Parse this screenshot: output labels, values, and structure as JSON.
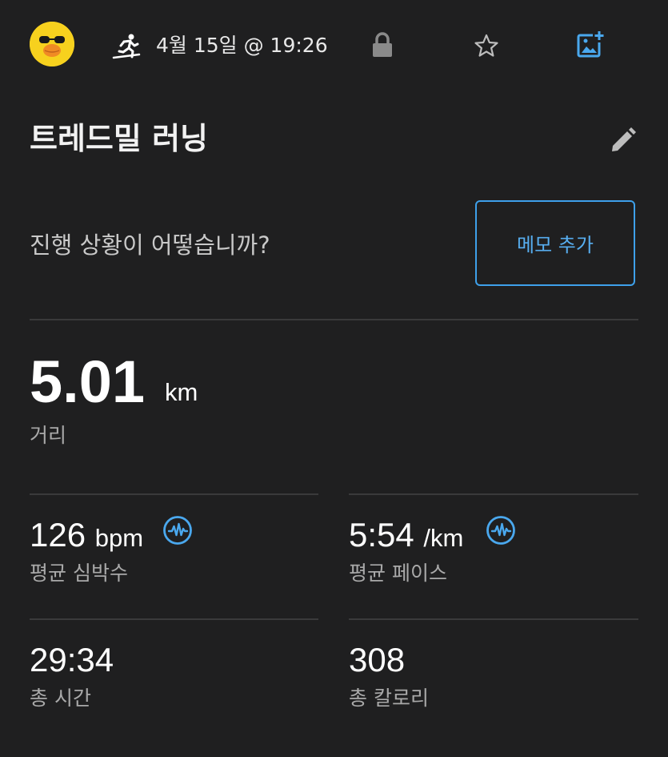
{
  "header": {
    "date_time": "4월 15일 @ 19:26",
    "icons": [
      "avatar-duck",
      "treadmill-run-icon",
      "lock-icon",
      "star-icon",
      "add-photo-icon"
    ]
  },
  "workout": {
    "title": "트레드밀 러닝",
    "prompt": "진행 상황이 어떻습니까?",
    "memo_button": "메모 추가"
  },
  "distance": {
    "value": "5.01",
    "unit": "km",
    "label": "거리"
  },
  "stats": {
    "heart_rate": {
      "value": "126",
      "unit": "bpm",
      "label": "평균 심박수"
    },
    "pace": {
      "value": "5:54",
      "unit": "/km",
      "label": "평균 페이스"
    },
    "total_time": {
      "value": "29:34",
      "label": "총 시간"
    },
    "calories": {
      "value": "308",
      "label": "총 칼로리"
    }
  },
  "colors": {
    "background": "#1f1f20",
    "accent": "#3ea0ea",
    "avatar": "#f7d11e"
  }
}
